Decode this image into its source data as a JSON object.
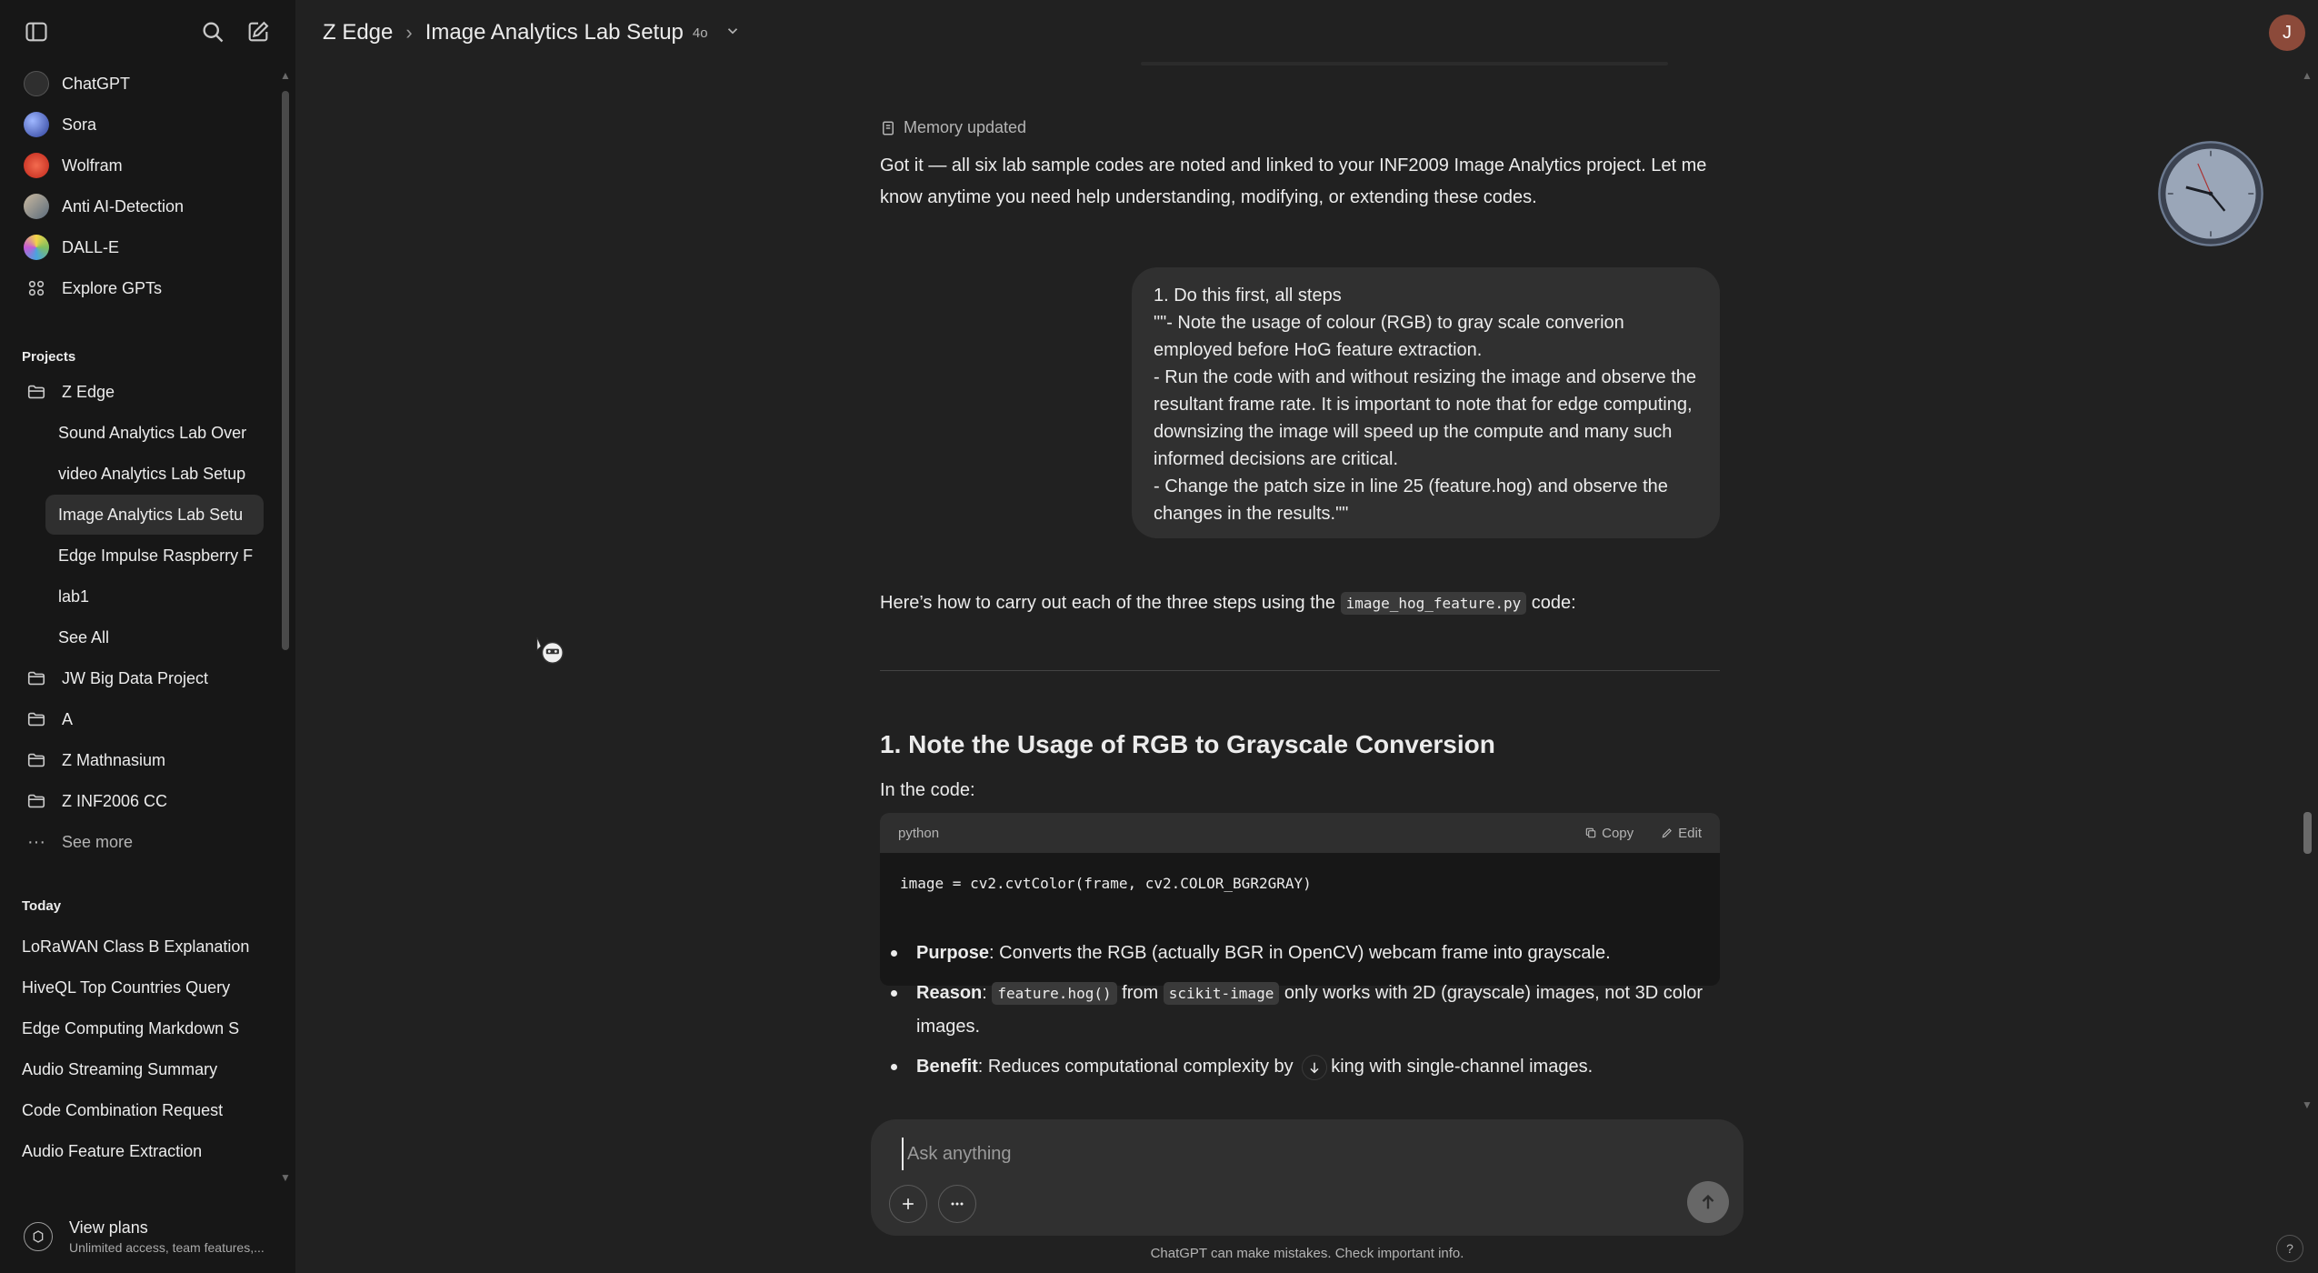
{
  "sidebar": {
    "gpts": [
      {
        "label": "ChatGPT",
        "icon": "chatgpt-logo-icon",
        "color": "#2f2f2f"
      },
      {
        "label": "Sora",
        "icon": "sora-logo-icon",
        "color": "#3a56c5"
      },
      {
        "label": "Wolfram",
        "icon": "wolfram-logo-icon",
        "color": "#d9381e"
      },
      {
        "label": "Anti AI-Detection",
        "icon": "anti-ai-detection-avatar",
        "color": "#8a7a6a"
      },
      {
        "label": "DALL-E",
        "icon": "dalle-logo-icon",
        "color": "#7fbf5f"
      }
    ],
    "explore_label": "Explore GPTs",
    "projects_title": "Projects",
    "projects": [
      {
        "label": "Z Edge"
      },
      {
        "label": "Sound Analytics Lab Over"
      },
      {
        "label": "video Analytics Lab Setup"
      },
      {
        "label": "Image Analytics Lab Setu"
      },
      {
        "label": "Edge Impulse Raspberry F"
      },
      {
        "label": "lab1"
      },
      {
        "label": "See All"
      },
      {
        "label": "JW Big Data Project"
      },
      {
        "label": "A"
      },
      {
        "label": "Z Mathnasium"
      },
      {
        "label": "Z INF2006 CC"
      }
    ],
    "see_more_label": "See more",
    "today_title": "Today",
    "today": [
      {
        "label": "LoRaWAN Class B Explanation"
      },
      {
        "label": "HiveQL Top Countries Query"
      },
      {
        "label": "Edge Computing Markdown S"
      },
      {
        "label": "Audio Streaming Summary"
      },
      {
        "label": "Code Combination Request"
      },
      {
        "label": "Audio Feature Extraction"
      }
    ],
    "plans": {
      "title": "View plans",
      "subtitle": "Unlimited access, team features,..."
    }
  },
  "header": {
    "project": "Z Edge",
    "chat_title": "Image Analytics Lab Setup",
    "model": "4o",
    "user_initial": "J"
  },
  "conversation": {
    "memory_label": "Memory updated",
    "assistant_reply_1": "Got it — all six lab sample codes are noted and linked to your INF2009 Image Analytics project. Let me know anytime you need help understanding, modifying, or extending these codes.",
    "user_message": "1. Do this first, all steps\n\"\"- Note the usage of colour (RGB) to gray scale converion employed before HoG feature extraction.\n- Run the code with and without resizing the image and observe the resultant frame rate. It is important to note that for edge computing, downsizing the image will speed up the compute and many such informed decisions are critical.\n- Change the patch size in line 25 (feature.hog) and observe the changes in the results.\"\"",
    "intro_before": "Here’s how to carry out each of the three steps using the ",
    "intro_code": "image_hog_feature.py",
    "intro_after": " code:",
    "section_heading": "1. Note the Usage of RGB to Grayscale Conversion",
    "in_the_code": "In the code:",
    "code_block": {
      "language": "python",
      "copy_label": "Copy",
      "edit_label": "Edit",
      "code": "image = cv2.cvtColor(frame, cv2.COLOR_BGR2GRAY)"
    },
    "bullets": {
      "purpose_label": "Purpose",
      "purpose_text": ": Converts the RGB (actually BGR in OpenCV) webcam frame into grayscale.",
      "reason_label": "Reason",
      "reason_code1": "feature.hog()",
      "reason_mid": " from ",
      "reason_code2": "scikit-image",
      "reason_text": " only works with 2D (grayscale) images, not 3D color images.",
      "benefit_label": "Benefit",
      "benefit_text_a": ": Reduces computational complexity by ",
      "benefit_text_b": "king with single-channel images."
    }
  },
  "composer": {
    "placeholder": "Ask anything"
  },
  "disclaimer": "ChatGPT can make mistakes. Check important info.",
  "help_label": "?"
}
